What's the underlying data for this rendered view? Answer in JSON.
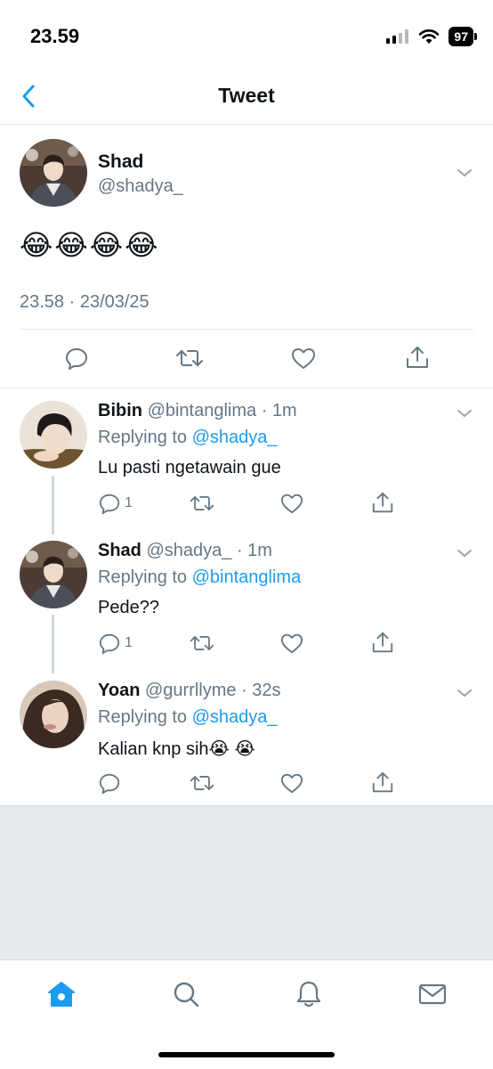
{
  "status_bar": {
    "time": "23.59",
    "battery": "97"
  },
  "header": {
    "title": "Tweet"
  },
  "main_tweet": {
    "name": "Shad",
    "handle": "@shadya_",
    "content": "😂😂😂😂",
    "meta": "23.58 · 23/03/25"
  },
  "replies": [
    {
      "name": "Bibin",
      "handle": "@bintanglima",
      "time": "· 1m",
      "replying_label": "Replying to",
      "replying_to": "@shadya_",
      "text": "Lu pasti ngetawain gue",
      "reply_count": "1"
    },
    {
      "name": "Shad",
      "handle": "@shadya_",
      "time": "· 1m",
      "replying_label": "Replying to",
      "replying_to": "@bintanglima",
      "text": "Pede??",
      "reply_count": "1"
    },
    {
      "name": "Yoan",
      "handle": "@gurrllyme",
      "time": "· 32s",
      "replying_label": "Replying to",
      "replying_to": "@shadya_",
      "text": "Kalian knp sih😭 😭",
      "reply_count": ""
    }
  ],
  "tab_bar": {
    "items": [
      "home-icon",
      "search-icon",
      "bell-icon",
      "mail-icon"
    ],
    "active_color": "#1d9bf0"
  },
  "colors": {
    "link": "#1d9bf0",
    "secondary": "#657786",
    "divider": "#e1e8ed"
  }
}
